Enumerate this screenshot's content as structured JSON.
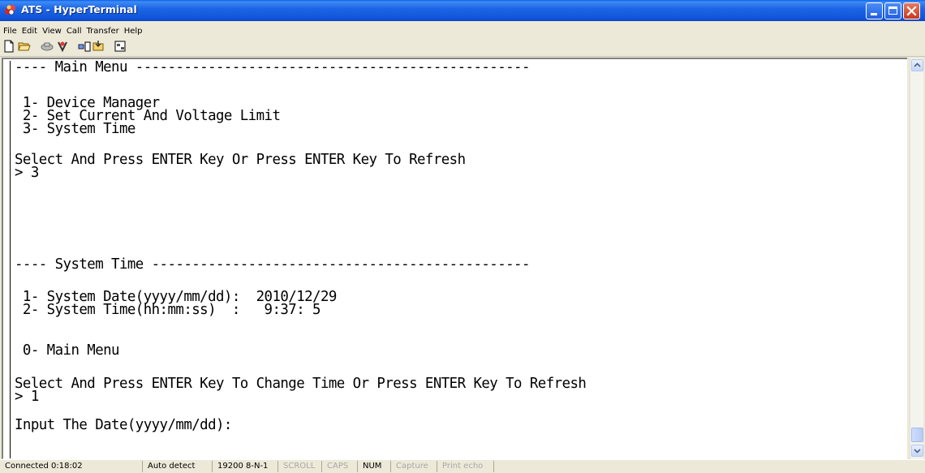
{
  "window": {
    "title": "ATS - HyperTerminal",
    "accent_color": "#0A5FE8",
    "buttons": [
      "minimize-icon",
      "maximize-icon",
      "close-icon"
    ]
  },
  "menu": [
    "File",
    "Edit",
    "View",
    "Call",
    "Transfer",
    "Help"
  ],
  "toolbar": {
    "icons": [
      "new-icon",
      "open-icon",
      "connect-icon",
      "disconnect-icon",
      "send-icon",
      "receive-icon",
      "properties-icon"
    ]
  },
  "terminal": {
    "lines": [
      "---- Main Menu -------------------------------------------------",
      "",
      " 1- Device Manager",
      " 2- Set Current And Voltage Limit",
      " 3- System Time",
      "",
      "Select And Press ENTER Key Or Press ENTER Key To Refresh",
      "> 3",
      "",
      "",
      "---- System Time -----------------------------------------------",
      "",
      " 1- System Date(yyyy/mm/dd):  2010/12/29",
      " 2- System Time(hh:mm:ss)  :   9:37: 5",
      "",
      " 0- Main Menu",
      "",
      "Select And Press ENTER Key To Change Time Or Press ENTER Key To Refresh",
      "> 1",
      "",
      "Input The Date(yyyy/mm/dd):"
    ]
  },
  "status": {
    "connected": "Connected 0:18:02",
    "detect": "Auto detect",
    "settings": "19200 8-N-1",
    "scroll": "SCROLL",
    "caps": "CAPS",
    "num": "NUM",
    "capture": "Capture",
    "print_echo": "Print echo"
  }
}
